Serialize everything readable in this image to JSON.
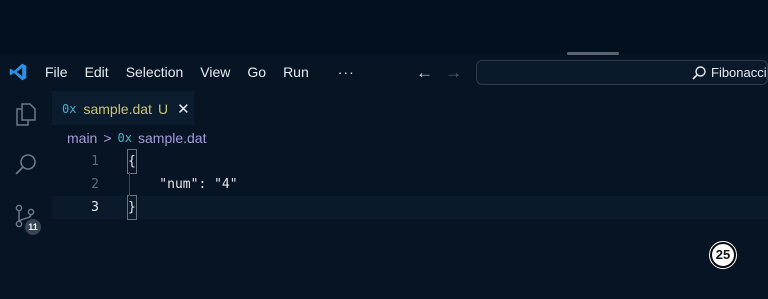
{
  "menu": {
    "items": [
      "File",
      "Edit",
      "Selection",
      "View",
      "Go",
      "Run"
    ],
    "more": "···"
  },
  "nav": {
    "back": "←",
    "forward": "→"
  },
  "search": {
    "text": "Fibonacci"
  },
  "activity": {
    "source_control_badge": "11"
  },
  "tab": {
    "glyph": "0x",
    "file_name": "sample.dat",
    "status": "U",
    "close": "✕"
  },
  "breadcrumb": {
    "root": "main",
    "separator": ">",
    "glyph": "0x",
    "file": "sample.dat"
  },
  "editor": {
    "lines": [
      {
        "number": "1",
        "code": "{"
      },
      {
        "number": "2",
        "code": "    \"num\": \"4\""
      },
      {
        "number": "3",
        "code": "}"
      }
    ],
    "current_line": "3"
  },
  "overlay": {
    "step_number": "25"
  },
  "colors": {
    "background": "#061424",
    "file_name": "#c9c37a",
    "breadcrumb": "#a79bd9",
    "glyph": "#3fb8c7"
  }
}
